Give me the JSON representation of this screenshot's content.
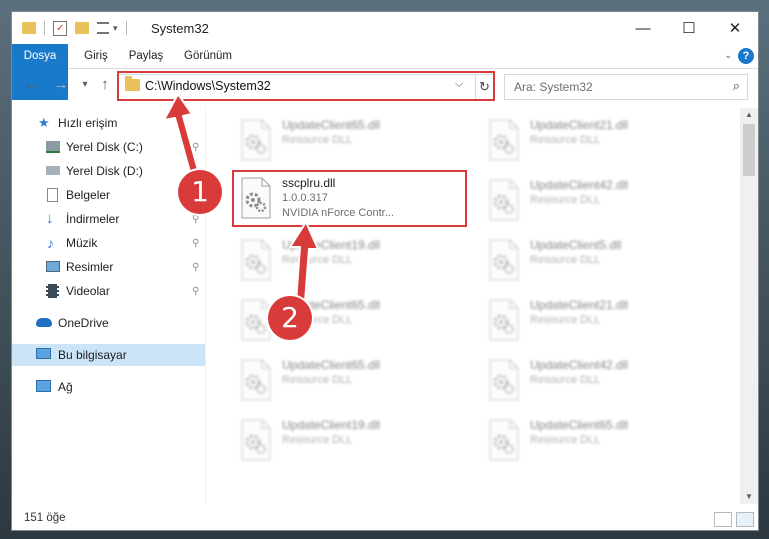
{
  "window": {
    "title": "System32",
    "controls": {
      "minimize": "—",
      "maximize": "☐",
      "close": "✕"
    }
  },
  "ribbon": {
    "tabs": [
      "Dosya",
      "Giriş",
      "Paylaş",
      "Görünüm"
    ],
    "help": "?"
  },
  "nav": {
    "back": "←",
    "forward": "→",
    "recent": "▾",
    "up": "↑",
    "address": "C:\\Windows\\System32",
    "address_dropdown": "⌵",
    "refresh": "↻",
    "search_placeholder": "Ara: System32",
    "search_icon": "⌕"
  },
  "sidebar": {
    "items": [
      {
        "label": "Hızlı erişim",
        "icon": "star-icon",
        "pinned": false
      },
      {
        "label": "Yerel Disk (C:)",
        "icon": "drive-icon",
        "pinned": true
      },
      {
        "label": "Yerel Disk (D:)",
        "icon": "drive-icon",
        "pinned": true
      },
      {
        "label": "Belgeler",
        "icon": "documents-icon",
        "pinned": true
      },
      {
        "label": "İndirmeler",
        "icon": "downloads-icon",
        "pinned": true
      },
      {
        "label": "Müzik",
        "icon": "music-icon",
        "pinned": true
      },
      {
        "label": "Resimler",
        "icon": "pictures-icon",
        "pinned": true
      },
      {
        "label": "Videolar",
        "icon": "videos-icon",
        "pinned": true
      },
      {
        "label": "OneDrive",
        "icon": "cloud-icon",
        "pinned": false
      },
      {
        "label": "Bu bilgisayar",
        "icon": "computer-icon",
        "pinned": false,
        "selected": true
      },
      {
        "label": "Ağ",
        "icon": "network-icon",
        "pinned": false
      }
    ],
    "pin_glyph": "📌"
  },
  "files": {
    "highlighted": {
      "name": "sscplru.dll",
      "version": "1.0.0.317",
      "description": "NVIDIA nForce Contr..."
    },
    "left_column": [
      {
        "name": "UpdateClient65.dll",
        "type": "Resource DLL"
      },
      null,
      {
        "name": "UpdateClient19.dll",
        "type": "Resource DLL"
      },
      {
        "name": "UpdateClient65.dll",
        "type": "Resource DLL"
      },
      {
        "name": "UpdateClient65.dll",
        "type": "Resource DLL"
      },
      {
        "name": "UpdateClient19.dll",
        "type": "Resource DLL"
      }
    ],
    "right_column": [
      {
        "name": "UpdateClient21.dll",
        "type": "Resource DLL"
      },
      {
        "name": "UpdateClient42.dll",
        "type": "Resource DLL"
      },
      {
        "name": "UpdateClient5.dll",
        "type": "Resource DLL"
      },
      {
        "name": "UpdateClient21.dll",
        "type": "Resource DLL"
      },
      {
        "name": "UpdateClient42.dll",
        "type": "Resource DLL"
      },
      {
        "name": "UpdateClient65.dll",
        "type": "Resource DLL"
      }
    ]
  },
  "status": {
    "item_count": "151 öğe"
  },
  "callouts": [
    "1",
    "2"
  ],
  "colors": {
    "accent": "#1979ca",
    "highlight": "#d93b3b",
    "selection": "#cce4f7"
  }
}
